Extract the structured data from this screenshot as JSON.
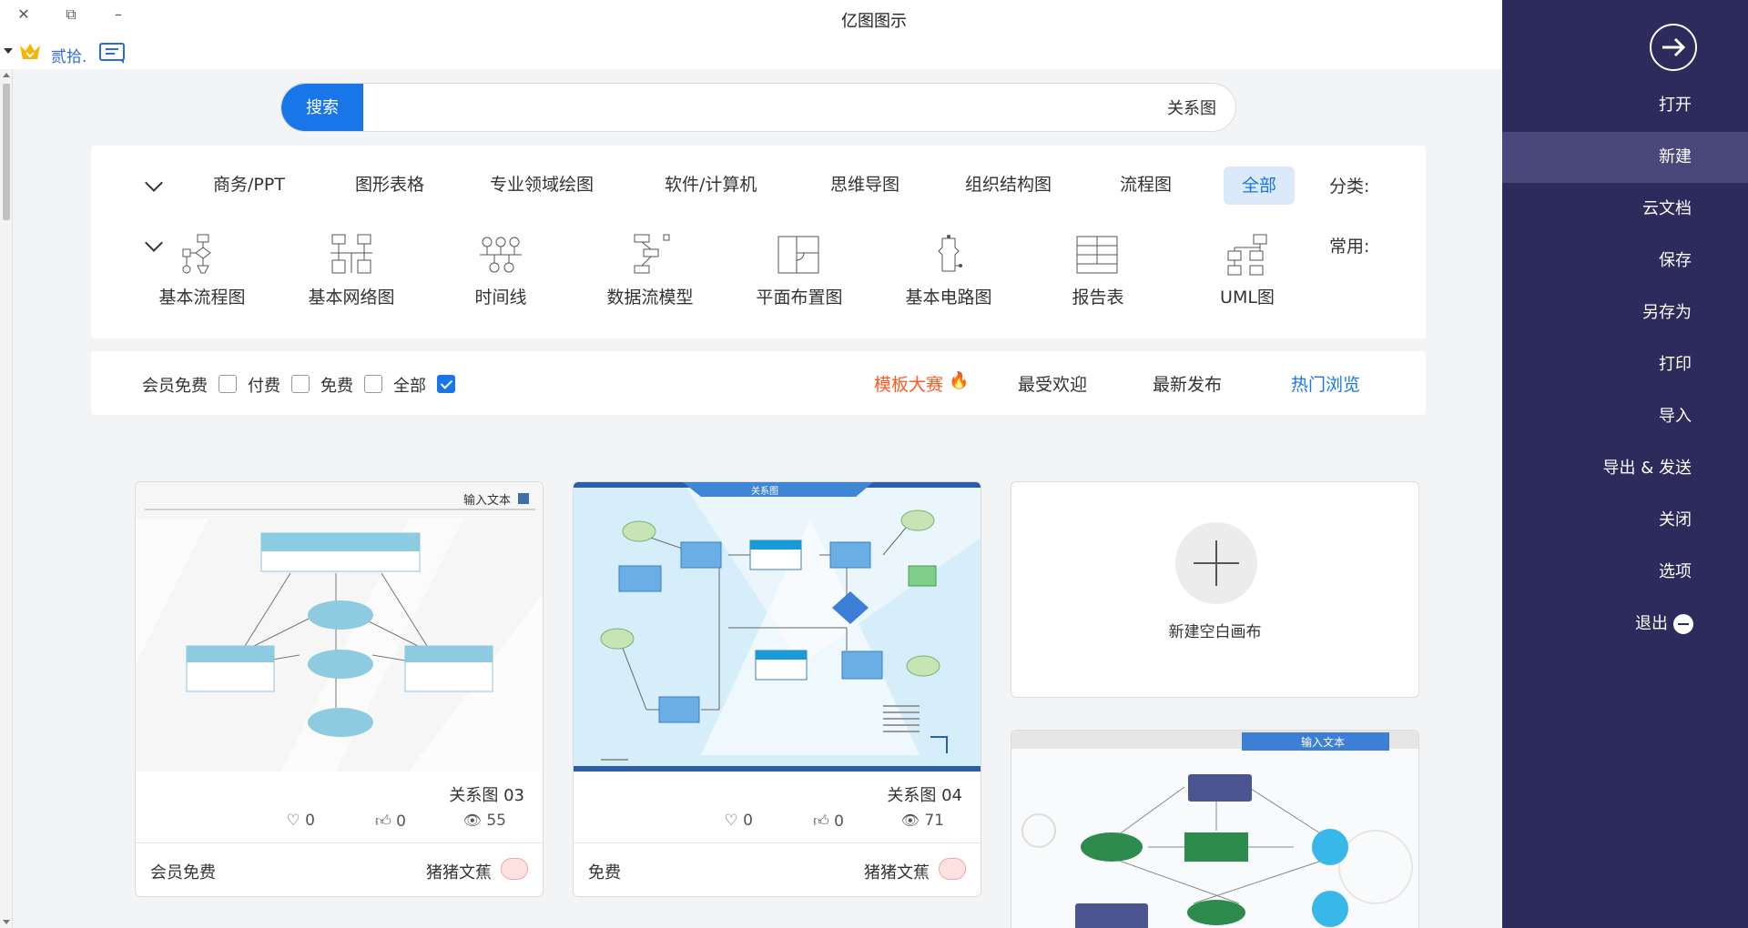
{
  "app": {
    "title": "亿图图示"
  },
  "window_controls": {
    "close": "✕",
    "restore": "⧉",
    "minimize": "–"
  },
  "user": {
    "name": "贰拾."
  },
  "search": {
    "button": "搜索",
    "value": "关系图"
  },
  "categories": {
    "label": "分类:",
    "active": "全部",
    "items": [
      "流程图",
      "组织结构图",
      "思维导图",
      "软件/计算机",
      "专业领域绘图",
      "图形表格",
      "商务/PPT"
    ]
  },
  "common": {
    "label": "常用:",
    "items": [
      "UML图",
      "报告表",
      "基本电路图",
      "平面布置图",
      "数据流模型",
      "时间线",
      "基本网络图",
      "基本流程图"
    ]
  },
  "filters": {
    "tabs": [
      "热门浏览",
      "最新发布",
      "最受欢迎"
    ],
    "contest": "模板大赛",
    "checkboxes": [
      "全部",
      "免费",
      "付费",
      "会员免费"
    ]
  },
  "new_blank": {
    "label": "新建空白画布"
  },
  "templates": [
    {
      "title": "关系图 04",
      "views": "71",
      "likes": "0",
      "favorites": "0",
      "author": "猪猪文蕉",
      "price": "免费",
      "banner": "关系图"
    },
    {
      "title": "关系图 03",
      "views": "55",
      "likes": "0",
      "favorites": "0",
      "author": "猪猪文蕉",
      "price": "会员免费",
      "banner": "输入文本"
    }
  ],
  "partial_card": {
    "banner": "输入文本"
  },
  "sidebar": {
    "items": [
      "打开",
      "新建",
      "云文档",
      "保存",
      "另存为",
      "打印",
      "导入",
      "导出 & 发送",
      "关闭",
      "选项",
      "退出"
    ],
    "active": "新建"
  },
  "colors": {
    "accent": "#1976e8",
    "sidebar": "#2d2a5c",
    "sidebar_active": "#4a477a",
    "contest": "#ff5a1f"
  }
}
